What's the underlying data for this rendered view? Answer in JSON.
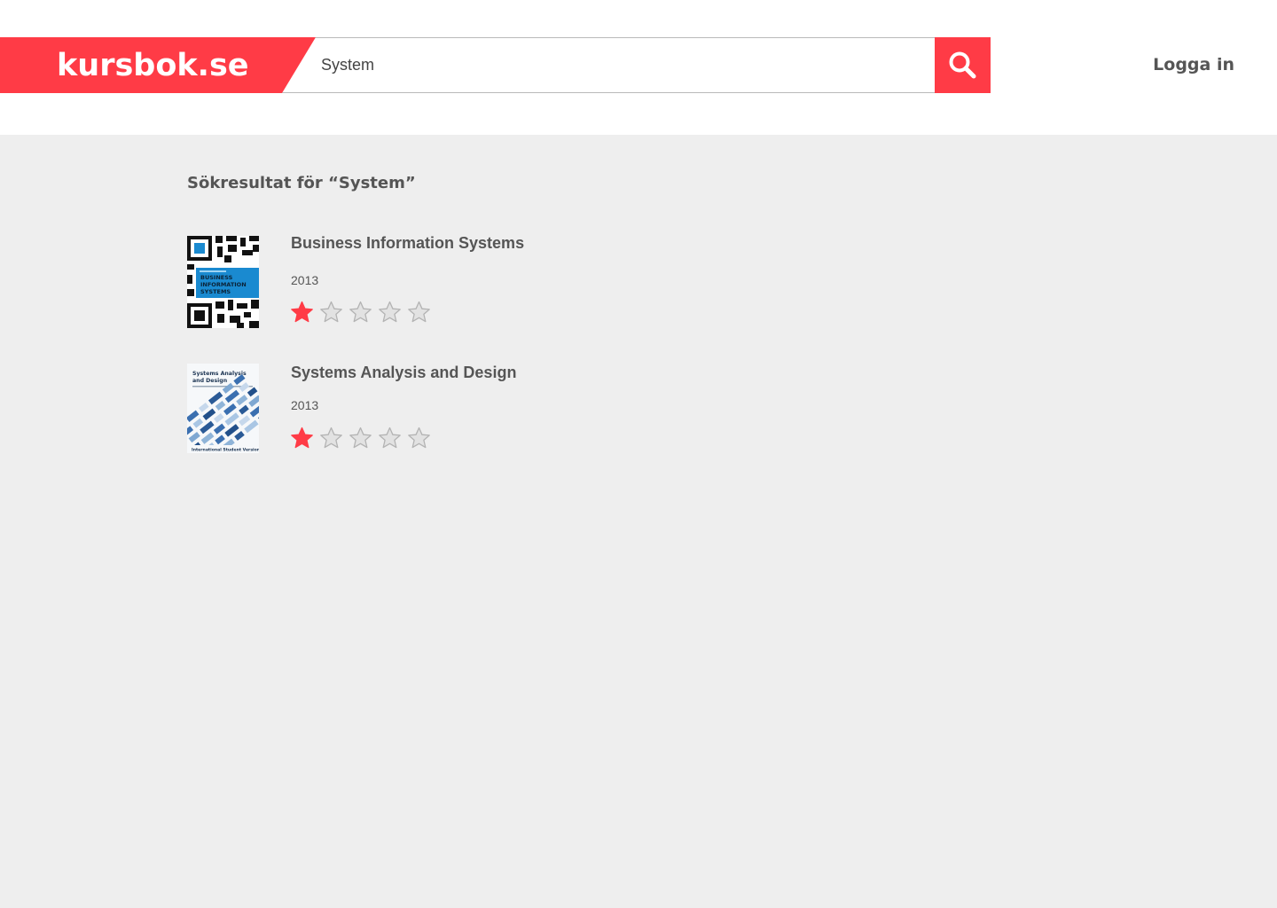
{
  "header": {
    "logo": "kursbok.se",
    "search": {
      "value": "System",
      "placeholder": ""
    },
    "search_icon": "search-icon",
    "login_label": "Logga in"
  },
  "results": {
    "heading": "Sökresultat för “System”",
    "items": [
      {
        "title": "Business Information Systems",
        "year": "2013",
        "rating": 1,
        "max_rating": 5,
        "cover": {
          "title_lines": [
            "BUSINESS",
            "INFORMATION",
            "SYSTEMS"
          ],
          "accent": "#1a8ad0"
        }
      },
      {
        "title": "Systems Analysis and Design",
        "year": "2013",
        "rating": 1,
        "max_rating": 5,
        "cover": {
          "title_lines": [
            "Systems Analysis",
            "and Design"
          ],
          "subtitle": "International Student Version",
          "accent": "#3a6fb0"
        }
      }
    ]
  },
  "colors": {
    "brand": "#ff3b46",
    "background": "#eeeeee",
    "text": "#555555",
    "star_empty": "#d0d0d0"
  }
}
